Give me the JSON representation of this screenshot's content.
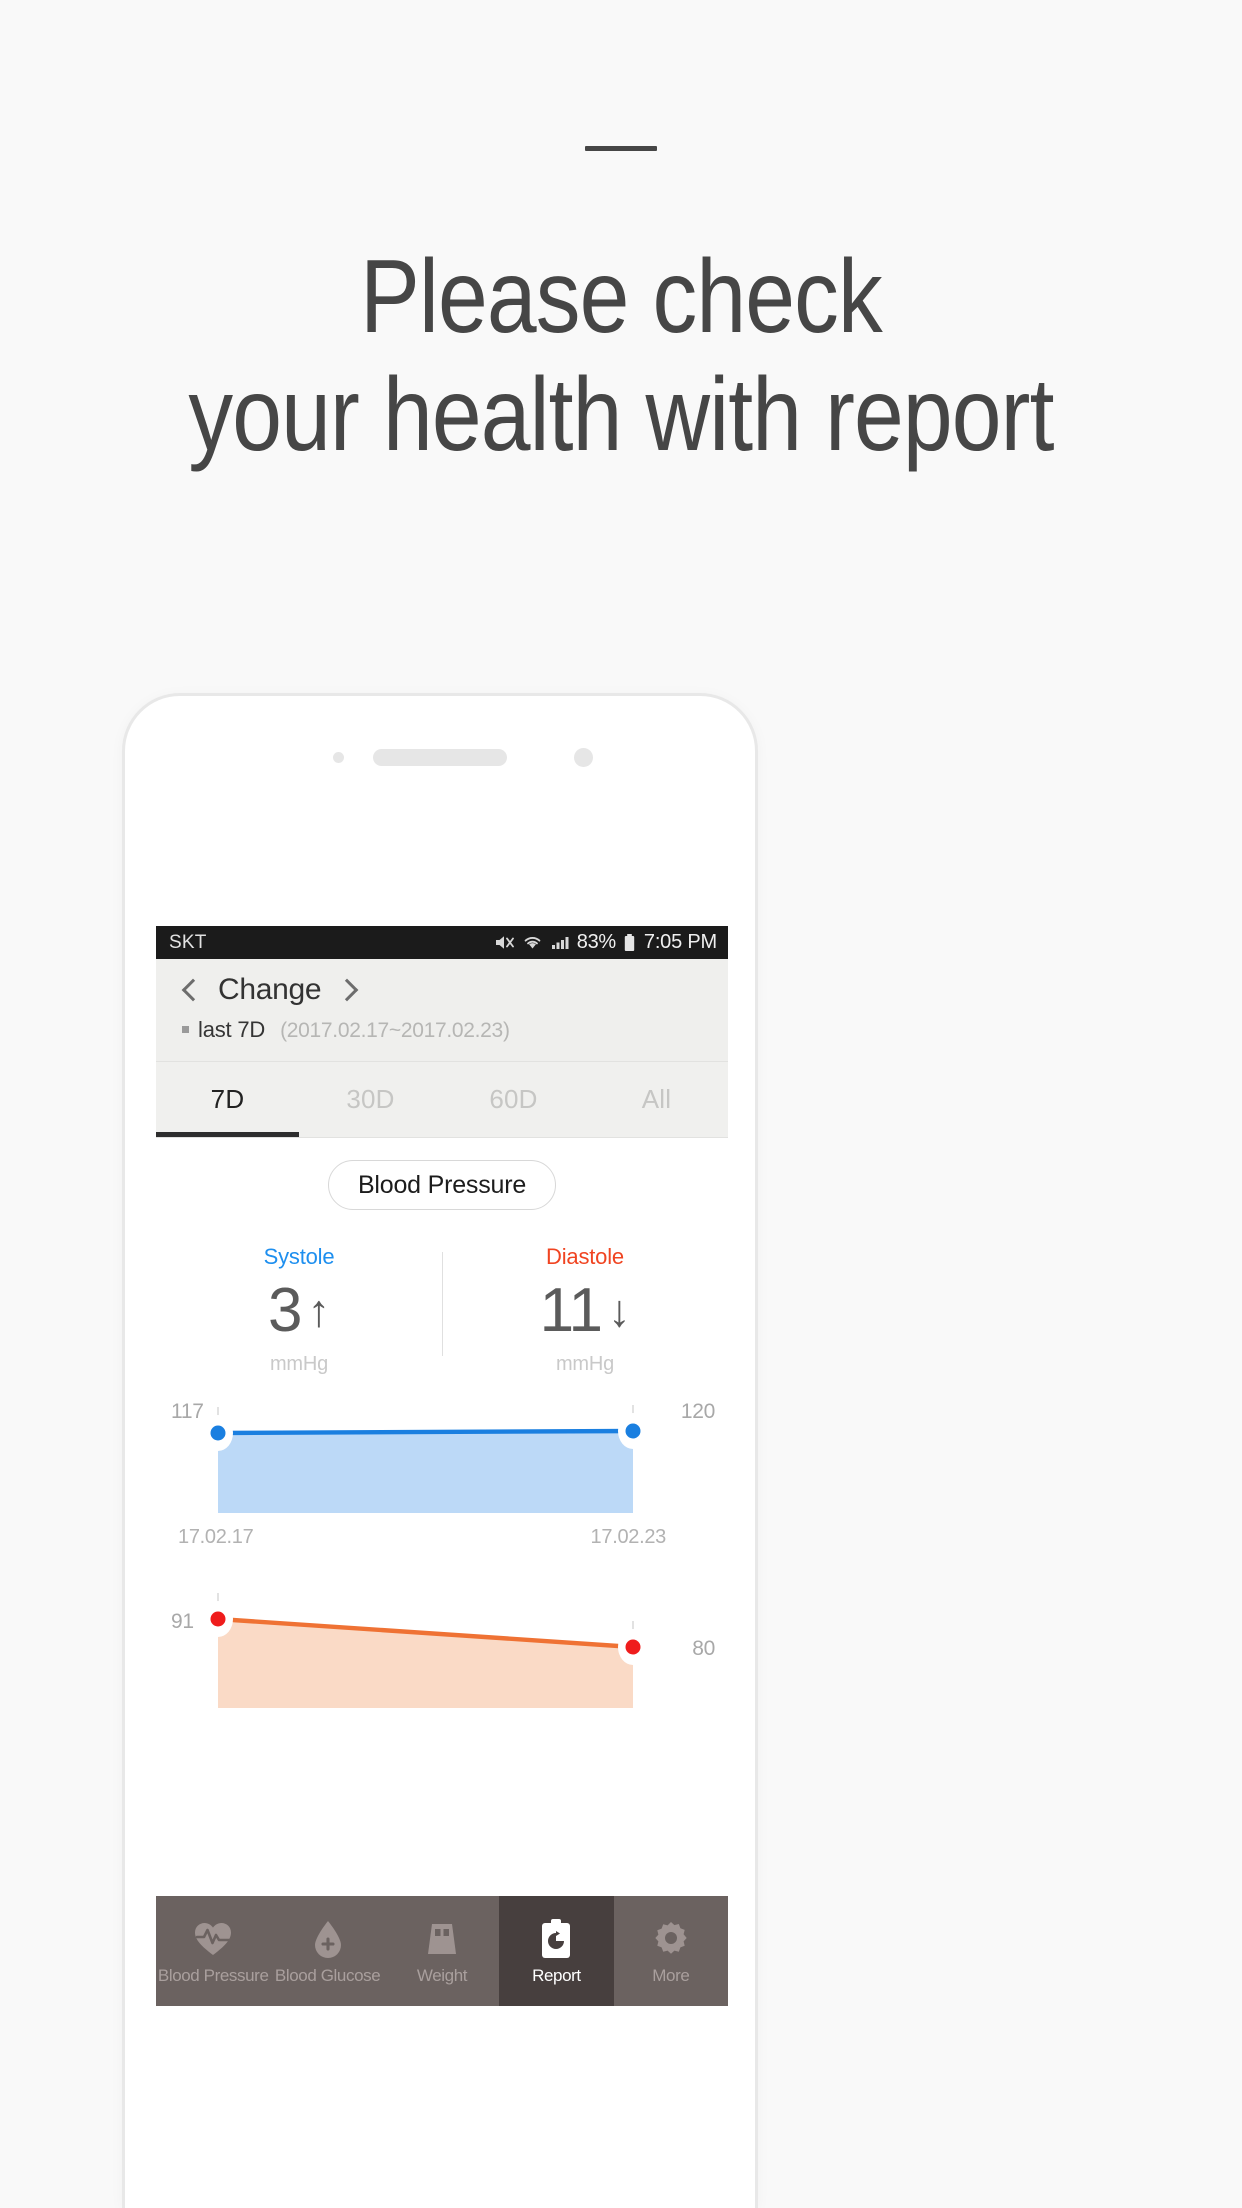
{
  "headline": {
    "line1": "Please check",
    "line2": "your health with report"
  },
  "phone": {
    "statusbar": {
      "carrier": "SKT",
      "battery_percent": "83%",
      "time": "7:05 PM",
      "icons": [
        "mute-icon",
        "wifi-icon",
        "signal-icon",
        "battery-icon"
      ]
    },
    "header": {
      "title": "Change",
      "prev_icon": "chevron-left-icon",
      "next_icon": "chevron-right-icon",
      "range_label": "last 7D",
      "range_dates": "(2017.02.17~2017.02.23)"
    },
    "tabs": [
      {
        "label": "7D",
        "active": true
      },
      {
        "label": "30D",
        "active": false
      },
      {
        "label": "60D",
        "active": false
      },
      {
        "label": "All",
        "active": false
      }
    ],
    "metric_pill": "Blood Pressure",
    "stats": [
      {
        "label": "Systole",
        "value": "3",
        "arrow": "↑",
        "unit": "mmHg",
        "color": "#1e8fef"
      },
      {
        "label": "Diastole",
        "value": "11",
        "arrow": "↓",
        "unit": "mmHg",
        "color": "#f04421"
      }
    ],
    "bottom_nav": [
      {
        "label": "Blood Pressure",
        "icon": "heart-pulse-icon",
        "active": false
      },
      {
        "label": "Blood Glucose",
        "icon": "blood-drop-icon",
        "active": false
      },
      {
        "label": "Weight",
        "icon": "scale-icon",
        "active": false
      },
      {
        "label": "Report",
        "icon": "clipboard-icon",
        "active": true
      },
      {
        "label": "More",
        "icon": "gear-icon",
        "active": false
      }
    ]
  },
  "chart_data": [
    {
      "type": "area",
      "title": "Systole",
      "x": [
        "17.02.17",
        "17.02.23"
      ],
      "values": [
        117,
        120
      ],
      "start_label": "117",
      "end_label": "120",
      "xlabel_start": "17.02.17",
      "xlabel_end": "17.02.23",
      "line_color": "#1a7fe0",
      "fill_color": "#bcd9f7",
      "point_color": "#1a7fe0",
      "grid": false,
      "ylabel": "mmHg"
    },
    {
      "type": "area",
      "title": "Diastole",
      "x": [
        "17.02.17",
        "17.02.23"
      ],
      "values": [
        91,
        80
      ],
      "start_label": "91",
      "end_label": "80",
      "xlabel_start": "17.02.17",
      "xlabel_end": "17.02.23",
      "line_color": "#ef7234",
      "fill_color": "#fadac6",
      "point_color": "#ef1c1c",
      "grid": false,
      "ylabel": "mmHg"
    }
  ]
}
